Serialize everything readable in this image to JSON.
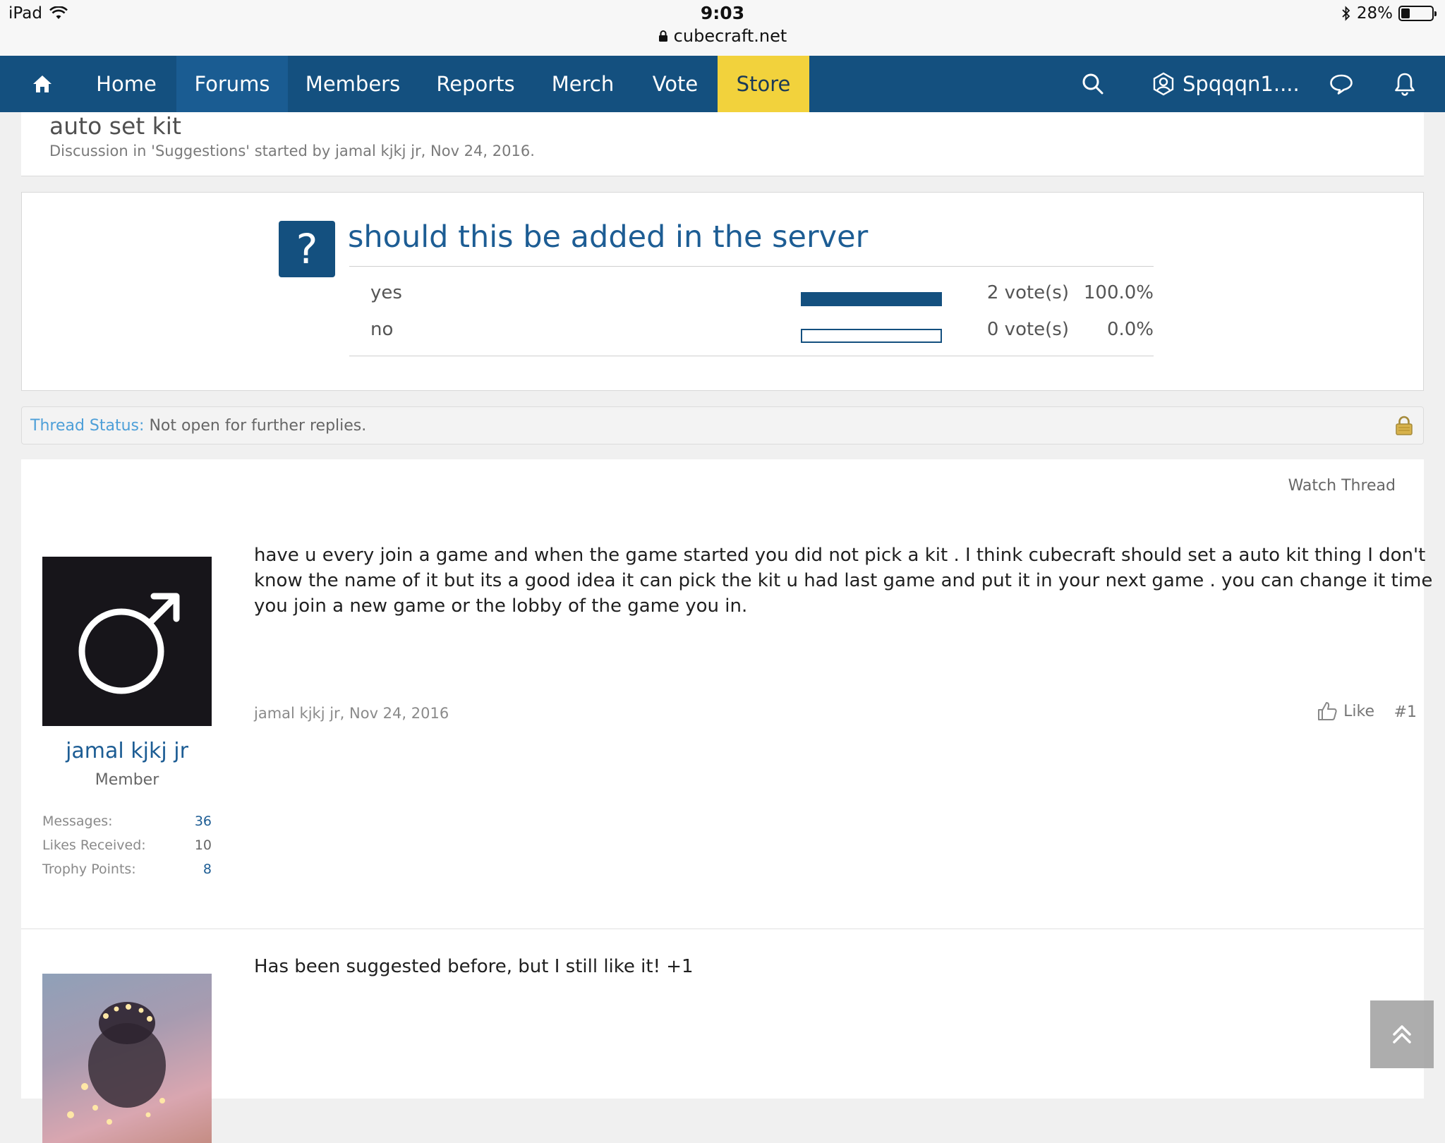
{
  "statusbar": {
    "device": "iPad",
    "time": "9:03",
    "url": "cubecraft.net",
    "battery": "28%",
    "battery_level": 0.28
  },
  "nav": {
    "items": [
      "Home",
      "Forums",
      "Members",
      "Reports",
      "Merch",
      "Vote",
      "Store"
    ],
    "active": "Forums",
    "username": "Spqqqn1...."
  },
  "thread": {
    "title": "auto set kit",
    "meta": "Discussion in 'Suggestions' started by jamal kjkj jr, Nov 24, 2016."
  },
  "poll": {
    "icon_text": "?",
    "question": "should this be added in the server",
    "options": [
      {
        "label": "yes",
        "votes": "2 vote(s)",
        "percent": "100.0%",
        "fraction": 1.0
      },
      {
        "label": "no",
        "votes": "0 vote(s)",
        "percent": "0.0%",
        "fraction": 0.0
      }
    ]
  },
  "thread_status": {
    "label": "Thread Status:",
    "text": "Not open for further replies."
  },
  "watch_thread": "Watch Thread",
  "posts": [
    {
      "author": "jamal kjkj jr",
      "role": "Member",
      "stats": [
        {
          "label": "Messages:",
          "value": "36"
        },
        {
          "label": "Likes Received:",
          "value": "10"
        },
        {
          "label": "Trophy Points:",
          "value": "8"
        }
      ],
      "message": "have u every join a game and when the game started you did not pick a kit . I think cubecraft should set a auto kit thing I don't know the name of it but its a good idea it can pick the kit u had last game and put it in your next game . you can change it time you join a new game or the lobby of the game you in.",
      "meta": "jamal kjkj jr, Nov 24, 2016",
      "like_label": "Like",
      "number": "#1"
    },
    {
      "message": "Has been suggested before, but I still like it! +1"
    }
  ],
  "colors": {
    "nav_bg": "#14507f",
    "store_bg": "#f2d23c",
    "link": "#1d5d94"
  }
}
